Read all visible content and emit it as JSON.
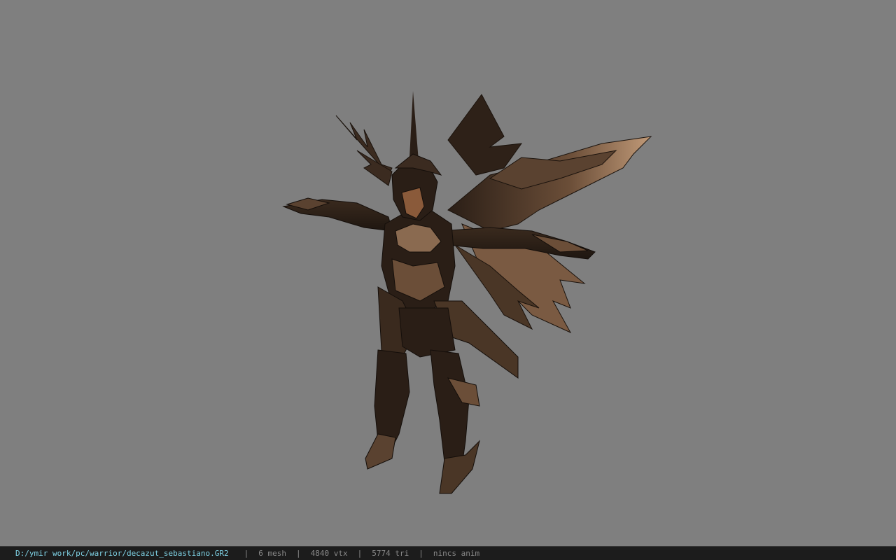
{
  "viewport": {
    "background_color": "#7f7f7f",
    "model_colors": {
      "armor_dark": "#231a14",
      "armor_mid": "#4a3626",
      "armor_light": "#b08a6a",
      "skin": "#8a5a3a"
    }
  },
  "status_bar": {
    "file_path": "D:/ymir work/pc/warrior/decazut_sebastiano.GR2",
    "separator": "|",
    "mesh": "6 mesh",
    "vtx": "4840 vtx",
    "tri": "5774 tri",
    "anim": "nincs anim",
    "path_color": "#7fd3e6",
    "text_color": "#8a8a8a"
  }
}
